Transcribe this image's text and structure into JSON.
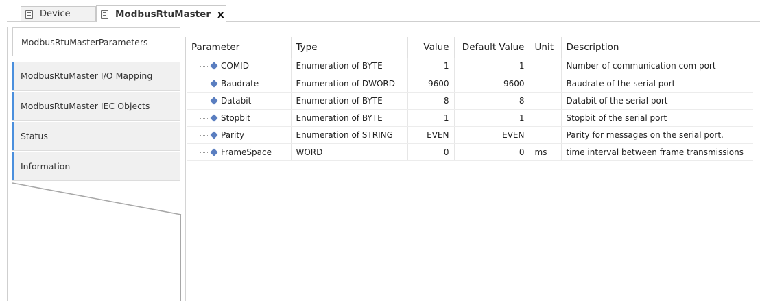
{
  "tabs": {
    "device_label": "Device",
    "active_label": "ModbusRtuMaster",
    "close_glyph": "x"
  },
  "sidebar": {
    "items": [
      {
        "label": "ModbusRtuMasterParameters"
      },
      {
        "label": "ModbusRtuMaster I/O Mapping"
      },
      {
        "label": "ModbusRtuMaster IEC Objects"
      },
      {
        "label": "Status"
      },
      {
        "label": "Information"
      }
    ]
  },
  "grid": {
    "headers": {
      "parameter": "Parameter",
      "type": "Type",
      "value": "Value",
      "default_value": "Default Value",
      "unit": "Unit",
      "description": "Description"
    },
    "rows": [
      {
        "parameter": "COMID",
        "type": "Enumeration of BYTE",
        "value": "1",
        "default_value": "1",
        "unit": "",
        "description": "Number of communication com port"
      },
      {
        "parameter": "Baudrate",
        "type": "Enumeration of DWORD",
        "value": "9600",
        "default_value": "9600",
        "unit": "",
        "description": "Baudrate of the serial port"
      },
      {
        "parameter": "Databit",
        "type": "Enumeration of BYTE",
        "value": "8",
        "default_value": "8",
        "unit": "",
        "description": "Databit of the serial port"
      },
      {
        "parameter": "Stopbit",
        "type": "Enumeration of BYTE",
        "value": "1",
        "default_value": "1",
        "unit": "",
        "description": "Stopbit of the serial port"
      },
      {
        "parameter": "Parity",
        "type": "Enumeration of STRING",
        "value": "EVEN",
        "default_value": "EVEN",
        "unit": "",
        "description": "Parity for messages on the serial port."
      },
      {
        "parameter": "FrameSpace",
        "type": "WORD",
        "value": "0",
        "default_value": "0",
        "unit": "ms",
        "description": "time interval between frame transmissions"
      }
    ]
  },
  "icons": {
    "tab": "device-page-icon",
    "parameter": "parameter-diamond-icon"
  },
  "colors": {
    "accent": "#4a8fdd",
    "parameter_icon": "#5a7ec0"
  }
}
